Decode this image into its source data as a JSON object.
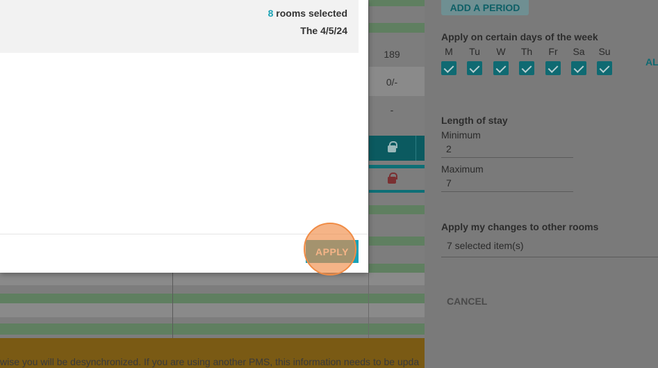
{
  "modal": {
    "rooms_count": "8",
    "rooms_selected_suffix": " rooms selected",
    "date_text": "The 4/5/24",
    "apply_label": "APPLY"
  },
  "grid": {
    "cells": [
      "189",
      "0/-",
      "-"
    ]
  },
  "warning_text": "wise you will be desynchronized. If you are using another PMS, this information needs to be upda",
  "side_panel": {
    "add_period_label": "ADD A PERIOD",
    "days_title": "Apply on certain days of the week",
    "days": [
      {
        "label": "M",
        "checked": true
      },
      {
        "label": "Tu",
        "checked": true
      },
      {
        "label": "W",
        "checked": true
      },
      {
        "label": "Th",
        "checked": true
      },
      {
        "label": "Fr",
        "checked": true
      },
      {
        "label": "Sa",
        "checked": true
      },
      {
        "label": "Su",
        "checked": true
      }
    ],
    "all_label": "AL",
    "length_of_stay_title": "Length of stay",
    "minimum_label": "Minimum",
    "minimum_value": "2",
    "maximum_label": "Maximum",
    "maximum_value": "7",
    "other_rooms_title": "Apply my changes to other rooms",
    "other_rooms_value": "7 selected item(s)",
    "cancel_label": "CANCEL"
  },
  "colors": {
    "accent": "#17a2b8",
    "click_highlight": "#f08c46"
  }
}
